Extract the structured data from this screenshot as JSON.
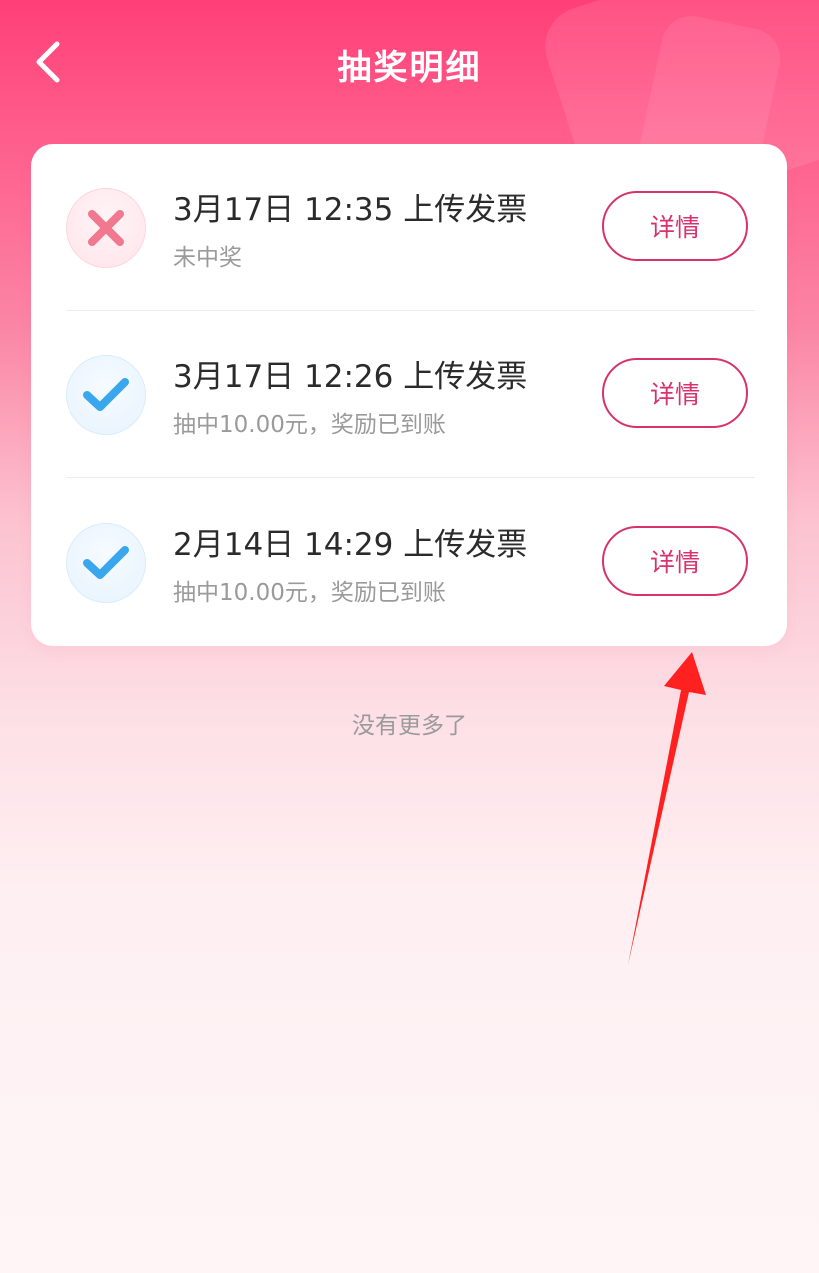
{
  "header": {
    "title": "抽奖明细",
    "back_icon": "chevron-left-icon"
  },
  "records": [
    {
      "status": "fail",
      "status_icon": "close-icon",
      "title": "3月17日 12:35 上传发票",
      "subtitle": "未中奖",
      "button_label": "详情"
    },
    {
      "status": "win",
      "status_icon": "check-icon",
      "title": "3月17日 12:26 上传发票",
      "subtitle": "抽中10.00元，奖励已到账",
      "button_label": "详情"
    },
    {
      "status": "win",
      "status_icon": "check-icon",
      "title": "2月14日 14:29 上传发票",
      "subtitle": "抽中10.00元，奖励已到账",
      "button_label": "详情"
    }
  ],
  "footer": {
    "no_more": "没有更多了"
  },
  "colors": {
    "accent": "#d6336c",
    "header_gradient_top": "#ff3f78",
    "fail_mark": "#f0788f",
    "win_mark": "#3aa6ee",
    "annotation_arrow": "#ff2020"
  }
}
